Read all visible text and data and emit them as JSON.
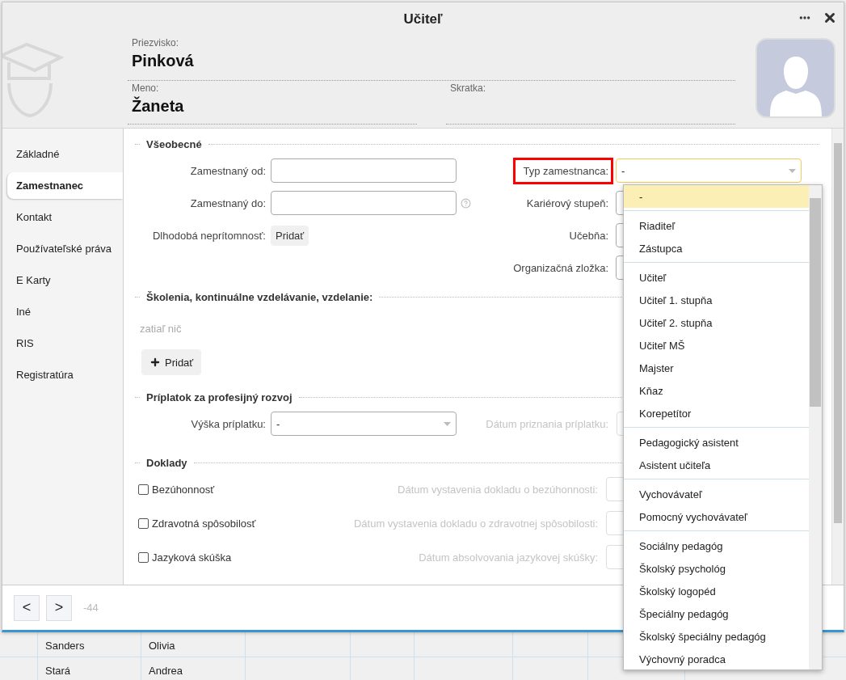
{
  "dialog": {
    "title": "Učiteľ",
    "surname": {
      "label": "Priezvisko:",
      "value": "Pinková"
    },
    "first_name": {
      "label": "Meno:",
      "value": "Žaneta"
    },
    "abbreviation": {
      "label": "Skratka:"
    }
  },
  "sidebar": {
    "items": [
      {
        "label": "Základné",
        "selected": false
      },
      {
        "label": "Zamestnanec",
        "selected": true
      },
      {
        "label": "Kontakt",
        "selected": false
      },
      {
        "label": "Používateľské práva",
        "selected": false
      },
      {
        "label": "E Karty",
        "selected": false
      },
      {
        "label": "Iné",
        "selected": false
      },
      {
        "label": "RIS",
        "selected": false
      },
      {
        "label": "Registratúra",
        "selected": false
      }
    ]
  },
  "general": {
    "title": "Všeobecné",
    "left_fields": [
      {
        "kind": "input",
        "label": "Zamestnaný od:",
        "help": false
      },
      {
        "kind": "input",
        "label": "Zamestnaný do:",
        "help": true
      },
      {
        "kind": "button",
        "label": "Dlhodobá neprítomnosť:",
        "button": "Pridať",
        "help": false
      }
    ],
    "right_fields": [
      {
        "label": "Typ zamestnanca:",
        "value": "-",
        "highlighted": true
      },
      {
        "label": "Kariérový stupeň:",
        "highlighted": false
      },
      {
        "label": "Učebňa:",
        "highlighted": false
      },
      {
        "label": "Organizačná zložka:",
        "highlighted": false
      }
    ]
  },
  "training": {
    "title": "Školenia, kontinuálne vzdelávanie, vzdelanie:",
    "empty_text": "zatiaľ nič",
    "add_button": "Pridať"
  },
  "allowance": {
    "title": "Príplatok za profesijný rozvoj",
    "amount_label": "Výška príplatku:",
    "amount_value": "-",
    "date_label": "Dátum priznania príplatku:",
    "date_disabled": true
  },
  "documents": {
    "title": "Doklady",
    "items": [
      {
        "label": "Bezúhonnosť",
        "checked": false,
        "date_label": "Dátum vystavenia dokladu o bezúhonnosti:",
        "date_disabled": true
      },
      {
        "label": "Zdravotná spôsobilosť",
        "checked": false,
        "date_label": "Dátum vystavenia dokladu o zdravotnej spôsobilosti:",
        "date_disabled": true
      },
      {
        "label": "Jazyková skúška",
        "checked": false,
        "date_label": "Dátum absolvovania jazykovej skúšky:",
        "date_disabled": true
      }
    ]
  },
  "footer": {
    "prev": "<",
    "next": ">",
    "counter": "-44"
  },
  "dropdown": {
    "groups": [
      {
        "options": [
          {
            "label": "-",
            "selected": true
          }
        ]
      },
      {
        "options": [
          {
            "label": "Riaditeľ",
            "selected": false
          },
          {
            "label": "Zástupca",
            "selected": false
          }
        ]
      },
      {
        "options": [
          {
            "label": "Učiteľ",
            "selected": false
          },
          {
            "label": "Učiteľ 1. stupňa",
            "selected": false
          },
          {
            "label": "Učiteľ 2. stupňa",
            "selected": false
          },
          {
            "label": "Učiteľ MŠ",
            "selected": false
          },
          {
            "label": "Majster",
            "selected": false
          },
          {
            "label": "Kňaz",
            "selected": false
          },
          {
            "label": "Korepetítor",
            "selected": false
          }
        ]
      },
      {
        "options": [
          {
            "label": "Pedagogický asistent",
            "selected": false
          },
          {
            "label": "Asistent učiteľa",
            "selected": false
          }
        ]
      },
      {
        "options": [
          {
            "label": "Vychovávateľ",
            "selected": false
          },
          {
            "label": "Pomocný vychovávateľ",
            "selected": false
          }
        ]
      },
      {
        "options": [
          {
            "label": "Sociálny pedagóg",
            "selected": false
          },
          {
            "label": "Školský psychológ",
            "selected": false
          },
          {
            "label": "Školský logopéd",
            "selected": false
          },
          {
            "label": "Špeciálny pedagóg",
            "selected": false
          },
          {
            "label": "Školský špeciálny pedagóg",
            "selected": false
          },
          {
            "label": "Výchovný poradca",
            "selected": false
          }
        ]
      }
    ]
  },
  "background_table": {
    "rows": [
      {
        "cells": [
          "Sanders",
          "Olivia"
        ]
      },
      {
        "cells": [
          "Stará",
          "Andrea"
        ]
      }
    ]
  }
}
